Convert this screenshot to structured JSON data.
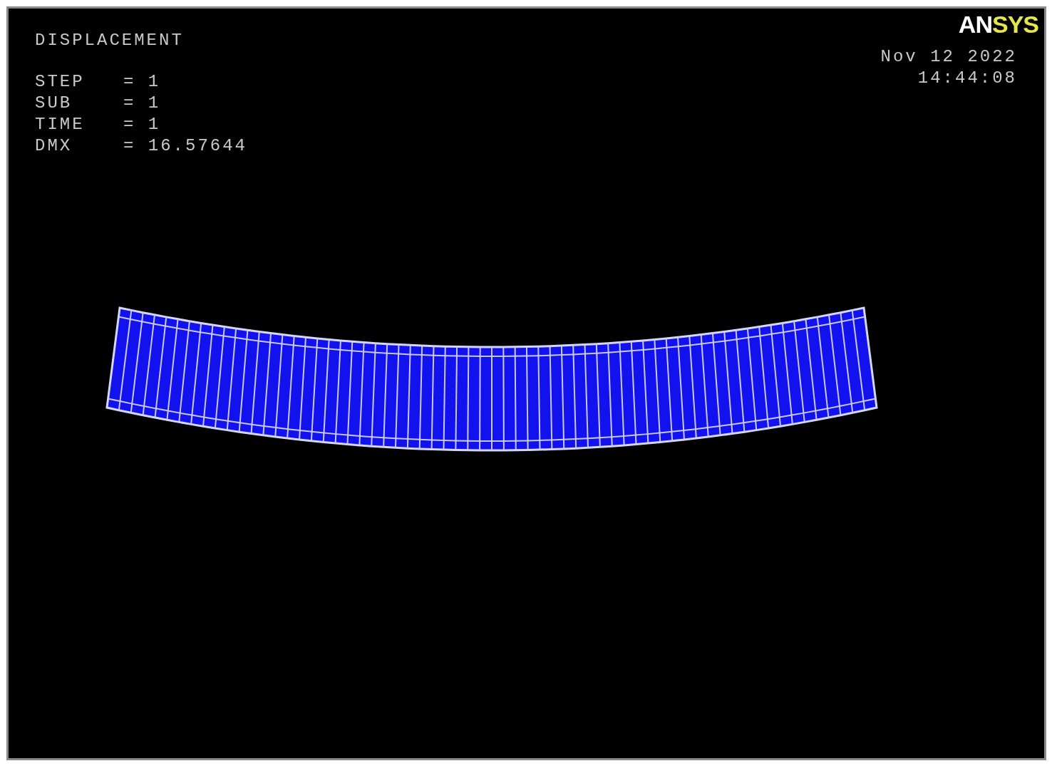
{
  "plot": {
    "title": "DISPLACEMENT",
    "values": [
      {
        "label": "STEP",
        "value": "= 1"
      },
      {
        "label": "SUB",
        "value": "= 1"
      },
      {
        "label": "TIME",
        "value": "= 1"
      },
      {
        "label": "DMX",
        "value": "= 16.57644"
      }
    ],
    "logo": [
      {
        "text": "AN",
        "color": "#ffffff"
      },
      {
        "text": "SYS",
        "color": "#e6e64a"
      }
    ],
    "date": "Nov 12 2022",
    "time": "14:44:08"
  }
}
